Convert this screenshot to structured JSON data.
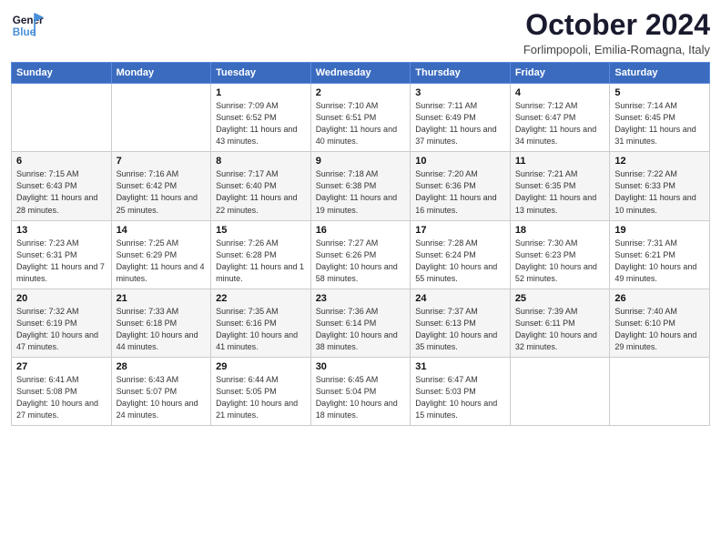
{
  "header": {
    "logo_line1": "General",
    "logo_line2": "Blue",
    "month_title": "October 2024",
    "location": "Forlimpopoli, Emilia-Romagna, Italy"
  },
  "weekdays": [
    "Sunday",
    "Monday",
    "Tuesday",
    "Wednesday",
    "Thursday",
    "Friday",
    "Saturday"
  ],
  "rows": [
    [
      {
        "num": "",
        "info": ""
      },
      {
        "num": "",
        "info": ""
      },
      {
        "num": "1",
        "info": "Sunrise: 7:09 AM\nSunset: 6:52 PM\nDaylight: 11 hours and 43 minutes."
      },
      {
        "num": "2",
        "info": "Sunrise: 7:10 AM\nSunset: 6:51 PM\nDaylight: 11 hours and 40 minutes."
      },
      {
        "num": "3",
        "info": "Sunrise: 7:11 AM\nSunset: 6:49 PM\nDaylight: 11 hours and 37 minutes."
      },
      {
        "num": "4",
        "info": "Sunrise: 7:12 AM\nSunset: 6:47 PM\nDaylight: 11 hours and 34 minutes."
      },
      {
        "num": "5",
        "info": "Sunrise: 7:14 AM\nSunset: 6:45 PM\nDaylight: 11 hours and 31 minutes."
      }
    ],
    [
      {
        "num": "6",
        "info": "Sunrise: 7:15 AM\nSunset: 6:43 PM\nDaylight: 11 hours and 28 minutes."
      },
      {
        "num": "7",
        "info": "Sunrise: 7:16 AM\nSunset: 6:42 PM\nDaylight: 11 hours and 25 minutes."
      },
      {
        "num": "8",
        "info": "Sunrise: 7:17 AM\nSunset: 6:40 PM\nDaylight: 11 hours and 22 minutes."
      },
      {
        "num": "9",
        "info": "Sunrise: 7:18 AM\nSunset: 6:38 PM\nDaylight: 11 hours and 19 minutes."
      },
      {
        "num": "10",
        "info": "Sunrise: 7:20 AM\nSunset: 6:36 PM\nDaylight: 11 hours and 16 minutes."
      },
      {
        "num": "11",
        "info": "Sunrise: 7:21 AM\nSunset: 6:35 PM\nDaylight: 11 hours and 13 minutes."
      },
      {
        "num": "12",
        "info": "Sunrise: 7:22 AM\nSunset: 6:33 PM\nDaylight: 11 hours and 10 minutes."
      }
    ],
    [
      {
        "num": "13",
        "info": "Sunrise: 7:23 AM\nSunset: 6:31 PM\nDaylight: 11 hours and 7 minutes."
      },
      {
        "num": "14",
        "info": "Sunrise: 7:25 AM\nSunset: 6:29 PM\nDaylight: 11 hours and 4 minutes."
      },
      {
        "num": "15",
        "info": "Sunrise: 7:26 AM\nSunset: 6:28 PM\nDaylight: 11 hours and 1 minute."
      },
      {
        "num": "16",
        "info": "Sunrise: 7:27 AM\nSunset: 6:26 PM\nDaylight: 10 hours and 58 minutes."
      },
      {
        "num": "17",
        "info": "Sunrise: 7:28 AM\nSunset: 6:24 PM\nDaylight: 10 hours and 55 minutes."
      },
      {
        "num": "18",
        "info": "Sunrise: 7:30 AM\nSunset: 6:23 PM\nDaylight: 10 hours and 52 minutes."
      },
      {
        "num": "19",
        "info": "Sunrise: 7:31 AM\nSunset: 6:21 PM\nDaylight: 10 hours and 49 minutes."
      }
    ],
    [
      {
        "num": "20",
        "info": "Sunrise: 7:32 AM\nSunset: 6:19 PM\nDaylight: 10 hours and 47 minutes."
      },
      {
        "num": "21",
        "info": "Sunrise: 7:33 AM\nSunset: 6:18 PM\nDaylight: 10 hours and 44 minutes."
      },
      {
        "num": "22",
        "info": "Sunrise: 7:35 AM\nSunset: 6:16 PM\nDaylight: 10 hours and 41 minutes."
      },
      {
        "num": "23",
        "info": "Sunrise: 7:36 AM\nSunset: 6:14 PM\nDaylight: 10 hours and 38 minutes."
      },
      {
        "num": "24",
        "info": "Sunrise: 7:37 AM\nSunset: 6:13 PM\nDaylight: 10 hours and 35 minutes."
      },
      {
        "num": "25",
        "info": "Sunrise: 7:39 AM\nSunset: 6:11 PM\nDaylight: 10 hours and 32 minutes."
      },
      {
        "num": "26",
        "info": "Sunrise: 7:40 AM\nSunset: 6:10 PM\nDaylight: 10 hours and 29 minutes."
      }
    ],
    [
      {
        "num": "27",
        "info": "Sunrise: 6:41 AM\nSunset: 5:08 PM\nDaylight: 10 hours and 27 minutes."
      },
      {
        "num": "28",
        "info": "Sunrise: 6:43 AM\nSunset: 5:07 PM\nDaylight: 10 hours and 24 minutes."
      },
      {
        "num": "29",
        "info": "Sunrise: 6:44 AM\nSunset: 5:05 PM\nDaylight: 10 hours and 21 minutes."
      },
      {
        "num": "30",
        "info": "Sunrise: 6:45 AM\nSunset: 5:04 PM\nDaylight: 10 hours and 18 minutes."
      },
      {
        "num": "31",
        "info": "Sunrise: 6:47 AM\nSunset: 5:03 PM\nDaylight: 10 hours and 15 minutes."
      },
      {
        "num": "",
        "info": ""
      },
      {
        "num": "",
        "info": ""
      }
    ]
  ]
}
